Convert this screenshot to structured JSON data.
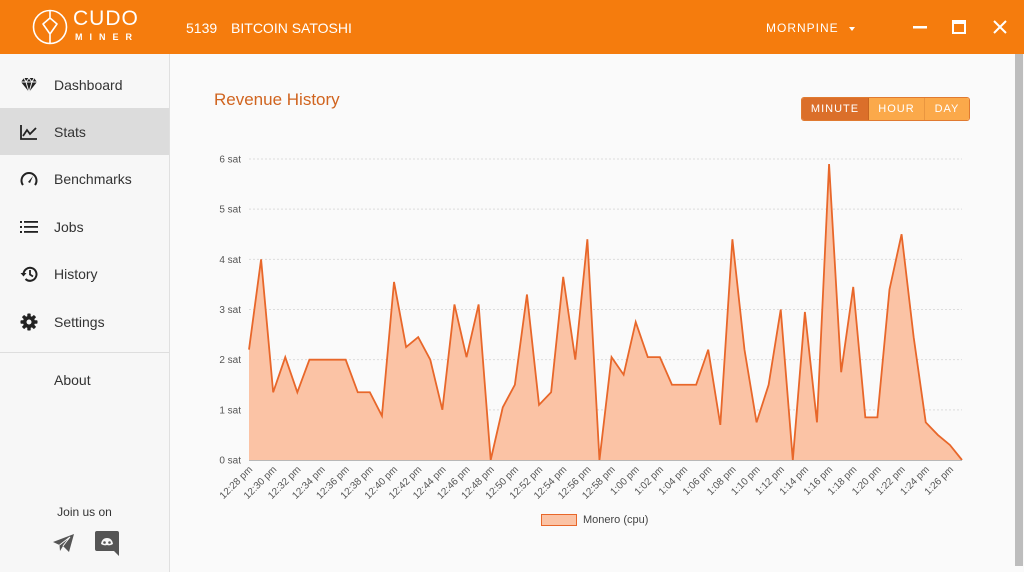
{
  "app": {
    "logo_line1": "CUDO",
    "logo_line2": "MINER",
    "balance_amount": "5139",
    "balance_unit": "BITCOIN SATOSHI",
    "username": "MORNPINE",
    "brand_color": "#f57c0d"
  },
  "window_controls": {
    "minimize": "minimize-icon",
    "maximize": "maximize-icon",
    "close": "close-icon"
  },
  "sidebar": {
    "items": [
      {
        "label": "Dashboard",
        "icon": "diamond-icon",
        "active": false
      },
      {
        "label": "Stats",
        "icon": "line-chart-icon",
        "active": true
      },
      {
        "label": "Benchmarks",
        "icon": "speedometer-icon",
        "active": false
      },
      {
        "label": "Jobs",
        "icon": "list-icon",
        "active": false
      },
      {
        "label": "History",
        "icon": "history-icon",
        "active": false
      },
      {
        "label": "Settings",
        "icon": "gear-icon",
        "active": false
      }
    ],
    "about_label": "About",
    "join_label": "Join us on",
    "social": [
      "telegram-icon",
      "discord-icon"
    ]
  },
  "main": {
    "title": "Revenue History",
    "ranges": [
      "MINUTE",
      "HOUR",
      "DAY"
    ],
    "selected_range": "MINUTE"
  },
  "chart_data": {
    "type": "area",
    "title": "Revenue History",
    "xlabel": "",
    "ylabel": "",
    "ylim": [
      0,
      6
    ],
    "yticks": [
      "0 sat",
      "1 sat",
      "2 sat",
      "3 sat",
      "4 sat",
      "5 sat",
      "6 sat"
    ],
    "grid": true,
    "legend_position": "bottom-center",
    "x": [
      "12:28 pm",
      "12:29 pm",
      "12:30 pm",
      "12:31 pm",
      "12:32 pm",
      "12:33 pm",
      "12:34 pm",
      "12:35 pm",
      "12:36 pm",
      "12:37 pm",
      "12:38 pm",
      "12:39 pm",
      "12:40 pm",
      "12:41 pm",
      "12:42 pm",
      "12:43 pm",
      "12:44 pm",
      "12:45 pm",
      "12:46 pm",
      "12:47 pm",
      "12:48 pm",
      "12:49 pm",
      "12:50 pm",
      "12:51 pm",
      "12:52 pm",
      "12:53 pm",
      "12:54 pm",
      "12:55 pm",
      "12:56 pm",
      "12:57 pm",
      "12:58 pm",
      "12:59 pm",
      "1:00 pm",
      "1:01 pm",
      "1:02 pm",
      "1:03 pm",
      "1:04 pm",
      "1:05 pm",
      "1:06 pm",
      "1:07 pm",
      "1:08 pm",
      "1:09 pm",
      "1:10 pm",
      "1:11 pm",
      "1:12 pm",
      "1:13 pm",
      "1:14 pm",
      "1:15 pm",
      "1:16 pm",
      "1:17 pm",
      "1:18 pm",
      "1:19 pm",
      "1:20 pm",
      "1:21 pm",
      "1:22 pm",
      "1:23 pm",
      "1:24 pm",
      "1:25 pm",
      "1:26 pm",
      "1:27 pm"
    ],
    "xtick_labels": [
      "12:28 pm",
      "12:30 pm",
      "12:32 pm",
      "12:34 pm",
      "12:36 pm",
      "12:38 pm",
      "12:40 pm",
      "12:42 pm",
      "12:44 pm",
      "12:46 pm",
      "12:48 pm",
      "12:50 pm",
      "12:52 pm",
      "12:54 pm",
      "12:56 pm",
      "12:58 pm",
      "1:00 pm",
      "1:02 pm",
      "1:04 pm",
      "1:06 pm",
      "1:08 pm",
      "1:10 pm",
      "1:12 pm",
      "1:14 pm",
      "1:16 pm",
      "1:18 pm",
      "1:20 pm",
      "1:22 pm",
      "1:24 pm",
      "1:26 pm"
    ],
    "series": [
      {
        "name": "Monero (cpu)",
        "line_color": "#e8672a",
        "fill_color": "#fbc3a5",
        "values": [
          2.2,
          4.0,
          1.35,
          2.05,
          1.35,
          2.0,
          2.0,
          2.0,
          2.0,
          1.35,
          1.35,
          0.88,
          3.55,
          2.25,
          2.45,
          2.0,
          1.0,
          3.1,
          2.05,
          3.1,
          0,
          1.05,
          1.5,
          3.3,
          1.1,
          1.35,
          3.65,
          2.0,
          4.4,
          0,
          2.05,
          1.7,
          2.75,
          2.05,
          2.05,
          1.5,
          1.5,
          1.5,
          2.2,
          0.7,
          4.4,
          2.2,
          0.75,
          1.5,
          3.0,
          0,
          2.95,
          0.75,
          5.9,
          1.75,
          3.45,
          0.85,
          0.85,
          3.4,
          4.5,
          2.45,
          0.75,
          0.5,
          0.3,
          0
        ]
      }
    ]
  }
}
